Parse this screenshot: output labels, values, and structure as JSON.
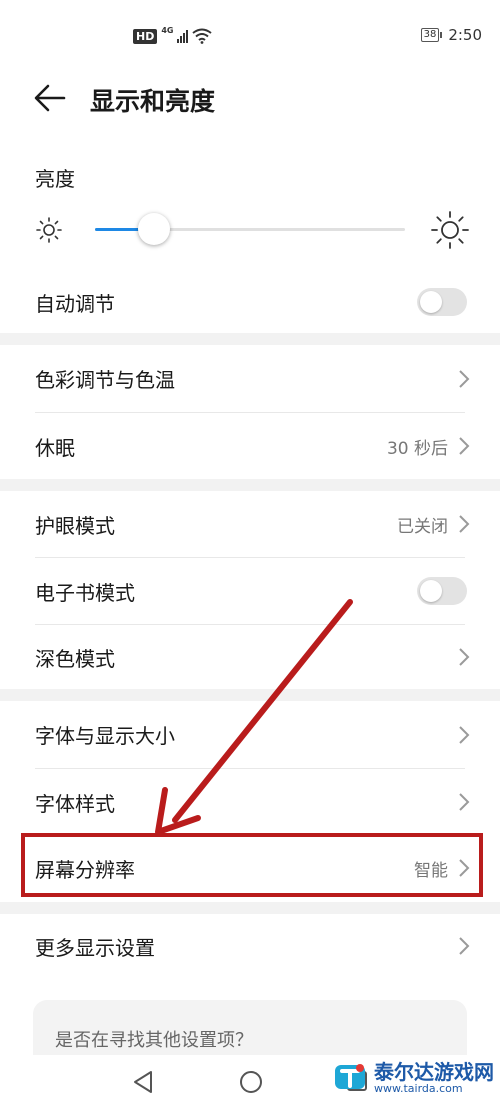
{
  "status": {
    "hd": "HD",
    "network": "4G",
    "battery": "38",
    "time": "2:50"
  },
  "header": {
    "title": "显示和亮度"
  },
  "brightness": {
    "label": "亮度",
    "level": 0.19
  },
  "items": {
    "auto_adjust": {
      "label": "自动调节",
      "toggle": false
    },
    "color_temp": {
      "label": "色彩调节与色温"
    },
    "sleep": {
      "label": "休眠",
      "value": "30 秒后"
    },
    "eye_comfort": {
      "label": "护眼模式",
      "value": "已关闭"
    },
    "ebook": {
      "label": "电子书模式",
      "toggle": false
    },
    "dark": {
      "label": "深色模式"
    },
    "font_size": {
      "label": "字体与显示大小"
    },
    "font_style": {
      "label": "字体样式"
    },
    "resolution": {
      "label": "屏幕分辨率",
      "value": "智能"
    },
    "more": {
      "label": "更多显示设置"
    }
  },
  "suggestion": {
    "text": "是否在寻找其他设置项？"
  },
  "watermark": {
    "cn": "泰尔达游戏网",
    "en": "www.tairda.com"
  },
  "colors": {
    "accent": "#1e88e5",
    "annotation": "#b91c1c",
    "watermark": "#1e5aa8"
  }
}
